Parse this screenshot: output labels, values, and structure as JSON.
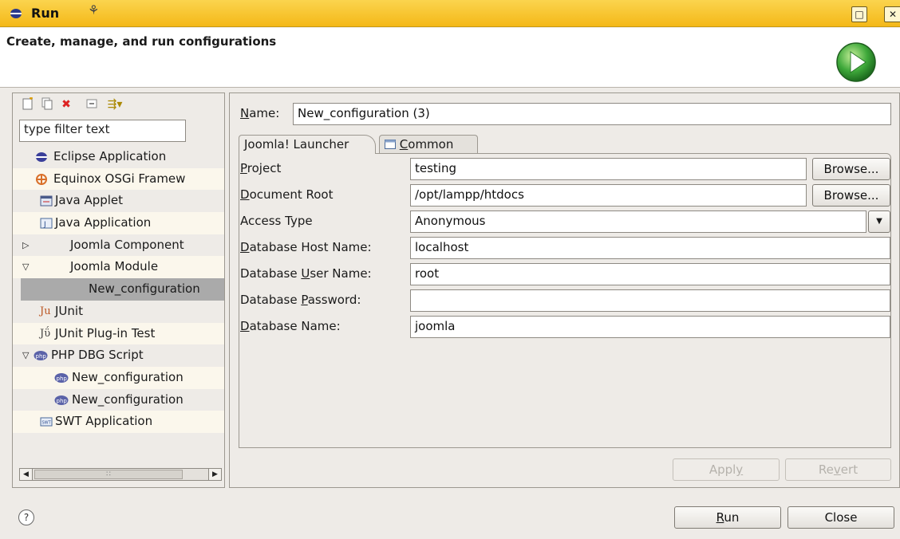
{
  "window": {
    "title": "Run",
    "maximize_glyph": "□",
    "close_glyph": "✕"
  },
  "header": {
    "title": "Create, manage, and run configurations"
  },
  "left": {
    "filter_placeholder": "type filter text",
    "tree": [
      {
        "label": "Eclipse Application",
        "icon": "eclipse-icon",
        "expander": ""
      },
      {
        "label": "Equinox OSGi Framew",
        "icon": "osgi-icon",
        "expander": ""
      },
      {
        "label": "Java Applet",
        "icon": "java-applet-icon",
        "expander": ""
      },
      {
        "label": "Java Application",
        "icon": "java-application-icon",
        "expander": ""
      },
      {
        "label": "Joomla Component",
        "icon": "",
        "expander": "▷"
      },
      {
        "label": "Joomla Module",
        "icon": "",
        "expander": "▽"
      },
      {
        "label": "New_configuration",
        "icon": "",
        "expander": ""
      },
      {
        "label": "JUnit",
        "icon": "junit-icon",
        "expander": ""
      },
      {
        "label": "JUnit Plug-in Test",
        "icon": "junit-plugin-icon",
        "expander": ""
      },
      {
        "label": "PHP DBG Script",
        "icon": "php-icon",
        "expander": "▽"
      },
      {
        "label": "New_configuration",
        "icon": "php-icon",
        "expander": ""
      },
      {
        "label": "New_configuration",
        "icon": "php-icon",
        "expander": ""
      },
      {
        "label": "SWT Application",
        "icon": "swt-icon",
        "expander": ""
      }
    ]
  },
  "form": {
    "name_label_u": "N",
    "name_label_rest": "ame:",
    "name_value": "New_configuration (3)",
    "tabs": {
      "launcher": "Joomla! Launcher",
      "common_u": "C",
      "common_rest": "ommon"
    },
    "fields": {
      "project": {
        "u": "P",
        "rest": "roject",
        "value": "testing"
      },
      "docroot": {
        "u": "D",
        "rest": "ocument Root",
        "value": "/opt/lampp/htdocs"
      },
      "access": {
        "label": "Access Type",
        "value": "Anonymous"
      },
      "dbhost": {
        "u": "D",
        "rest": "atabase Host Name:",
        "value": "localhost"
      },
      "dbuser": {
        "pre": "Database ",
        "u": "U",
        "rest": "ser Name:",
        "value": "root"
      },
      "dbpass": {
        "pre": "Database ",
        "u": "P",
        "rest": "assword:",
        "value": ""
      },
      "dbname": {
        "u": "D",
        "rest": "atabase Name:",
        "value": "joomla"
      }
    },
    "browse_label": "Browse...",
    "apply": {
      "pre": "Appl",
      "u": "y"
    },
    "revert": {
      "pre": "Re",
      "u": "v",
      "rest": "ert"
    }
  },
  "footer": {
    "help_glyph": "?",
    "run": {
      "u": "R",
      "rest": "un"
    },
    "close": "Close"
  },
  "colors": {
    "title_bar": "#f4b818",
    "selection": "#aaaaaa"
  }
}
